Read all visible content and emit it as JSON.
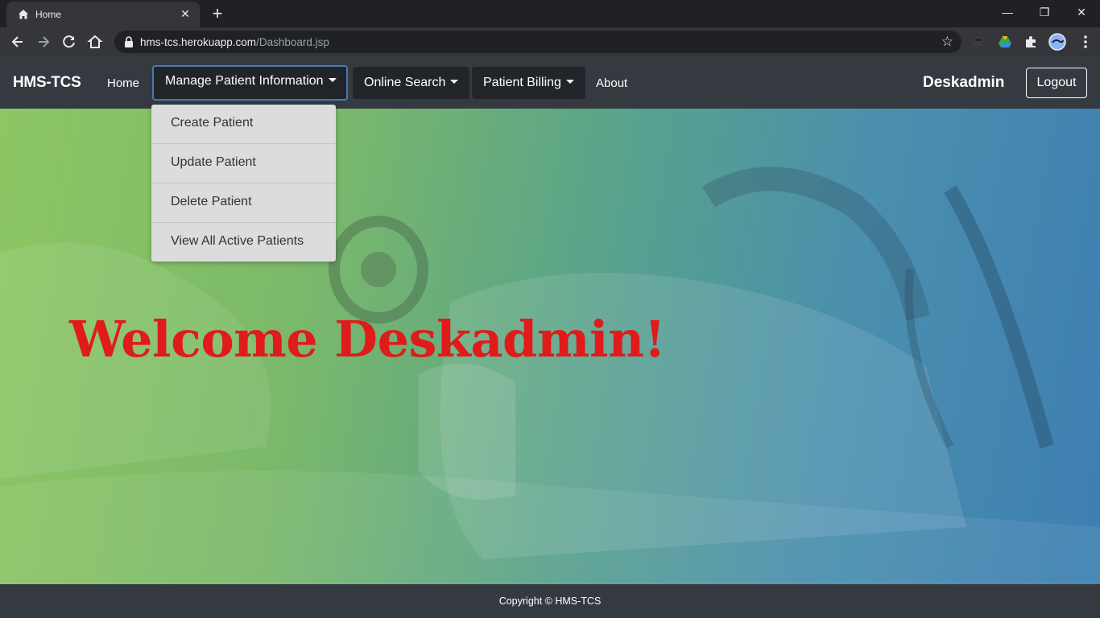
{
  "browser": {
    "tab_title": "Home",
    "tab_close": "✕",
    "new_tab": "+",
    "url_host": "hms-tcs.herokuapp.com",
    "url_path": "/Dashboard.jsp",
    "window_controls": [
      "—",
      "❐",
      "✕"
    ]
  },
  "navbar": {
    "brand": "HMS-TCS",
    "home": "Home",
    "manage_patient": "Manage Patient Information",
    "online_search": "Online Search",
    "patient_billing": "Patient Billing",
    "about": "About",
    "user": "Deskadmin",
    "logout": "Logout"
  },
  "dropdown": {
    "items": [
      "Create Patient",
      "Update Patient",
      "Delete Patient",
      "View All Active Patients"
    ]
  },
  "hero": {
    "welcome": "Welcome Deskadmin!"
  },
  "footer": {
    "copyright": "Copyright © HMS-TCS"
  },
  "colors": {
    "navbar_bg": "#343a40",
    "dropdown_btn_bg": "#212529",
    "welcome_text": "#e01b1b",
    "dropdown_bg": "#dcdcdc"
  },
  "icons": [
    "home-icon",
    "back-icon",
    "forward-icon",
    "reload-icon",
    "lock-icon",
    "star-icon",
    "extensions-icon",
    "drive-icon",
    "profile-icon",
    "menu-icon"
  ]
}
